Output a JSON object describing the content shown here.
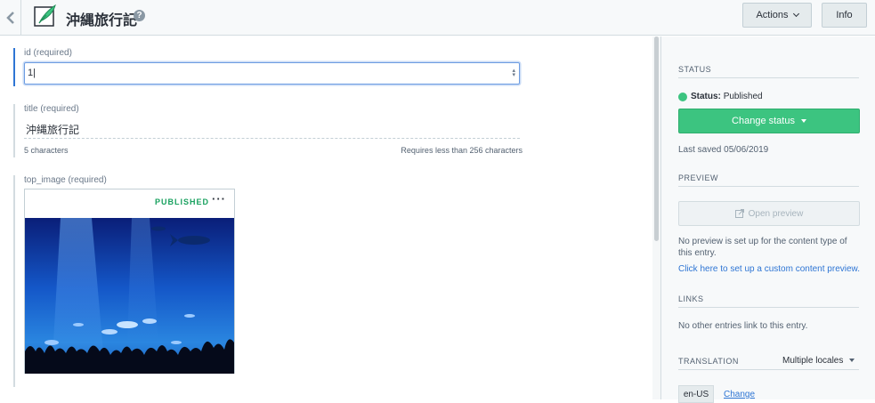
{
  "header": {
    "title": "沖縄旅行記",
    "actions_label": "Actions",
    "info_label": "Info"
  },
  "fields": {
    "id": {
      "label": "id (required)",
      "value": "1|"
    },
    "title": {
      "label": "title (required)",
      "value": "沖縄旅行記",
      "char_count": "5 characters",
      "char_limit": "Requires less than 256 characters"
    },
    "top_image": {
      "label": "top_image (required)",
      "status": "PUBLISHED",
      "more": "···"
    }
  },
  "sidebar": {
    "status_heading": "STATUS",
    "status_label": "Status:",
    "status_value": "Published",
    "change_status_label": "Change status",
    "last_saved": "Last saved 05/06/2019",
    "preview_heading": "PREVIEW",
    "open_preview_label": "Open preview",
    "no_preview_text": "No preview is set up for the content type of this entry.",
    "preview_link": "Click here to set up a custom content preview.",
    "links_heading": "LINKS",
    "no_links_text": "No other entries link to this entry.",
    "translation_heading": "TRANSLATION",
    "locales_label": "Multiple locales",
    "locale_tag": "en-US",
    "change_link": "Change"
  },
  "colors": {
    "accent_green": "#3cc480",
    "link_blue": "#2e75d4",
    "focus_blue": "#6e9de2"
  },
  "icons": {
    "back": "chevron-left-icon",
    "entry": "feather-icon",
    "help": "question-icon",
    "preview": "external-link-icon"
  }
}
